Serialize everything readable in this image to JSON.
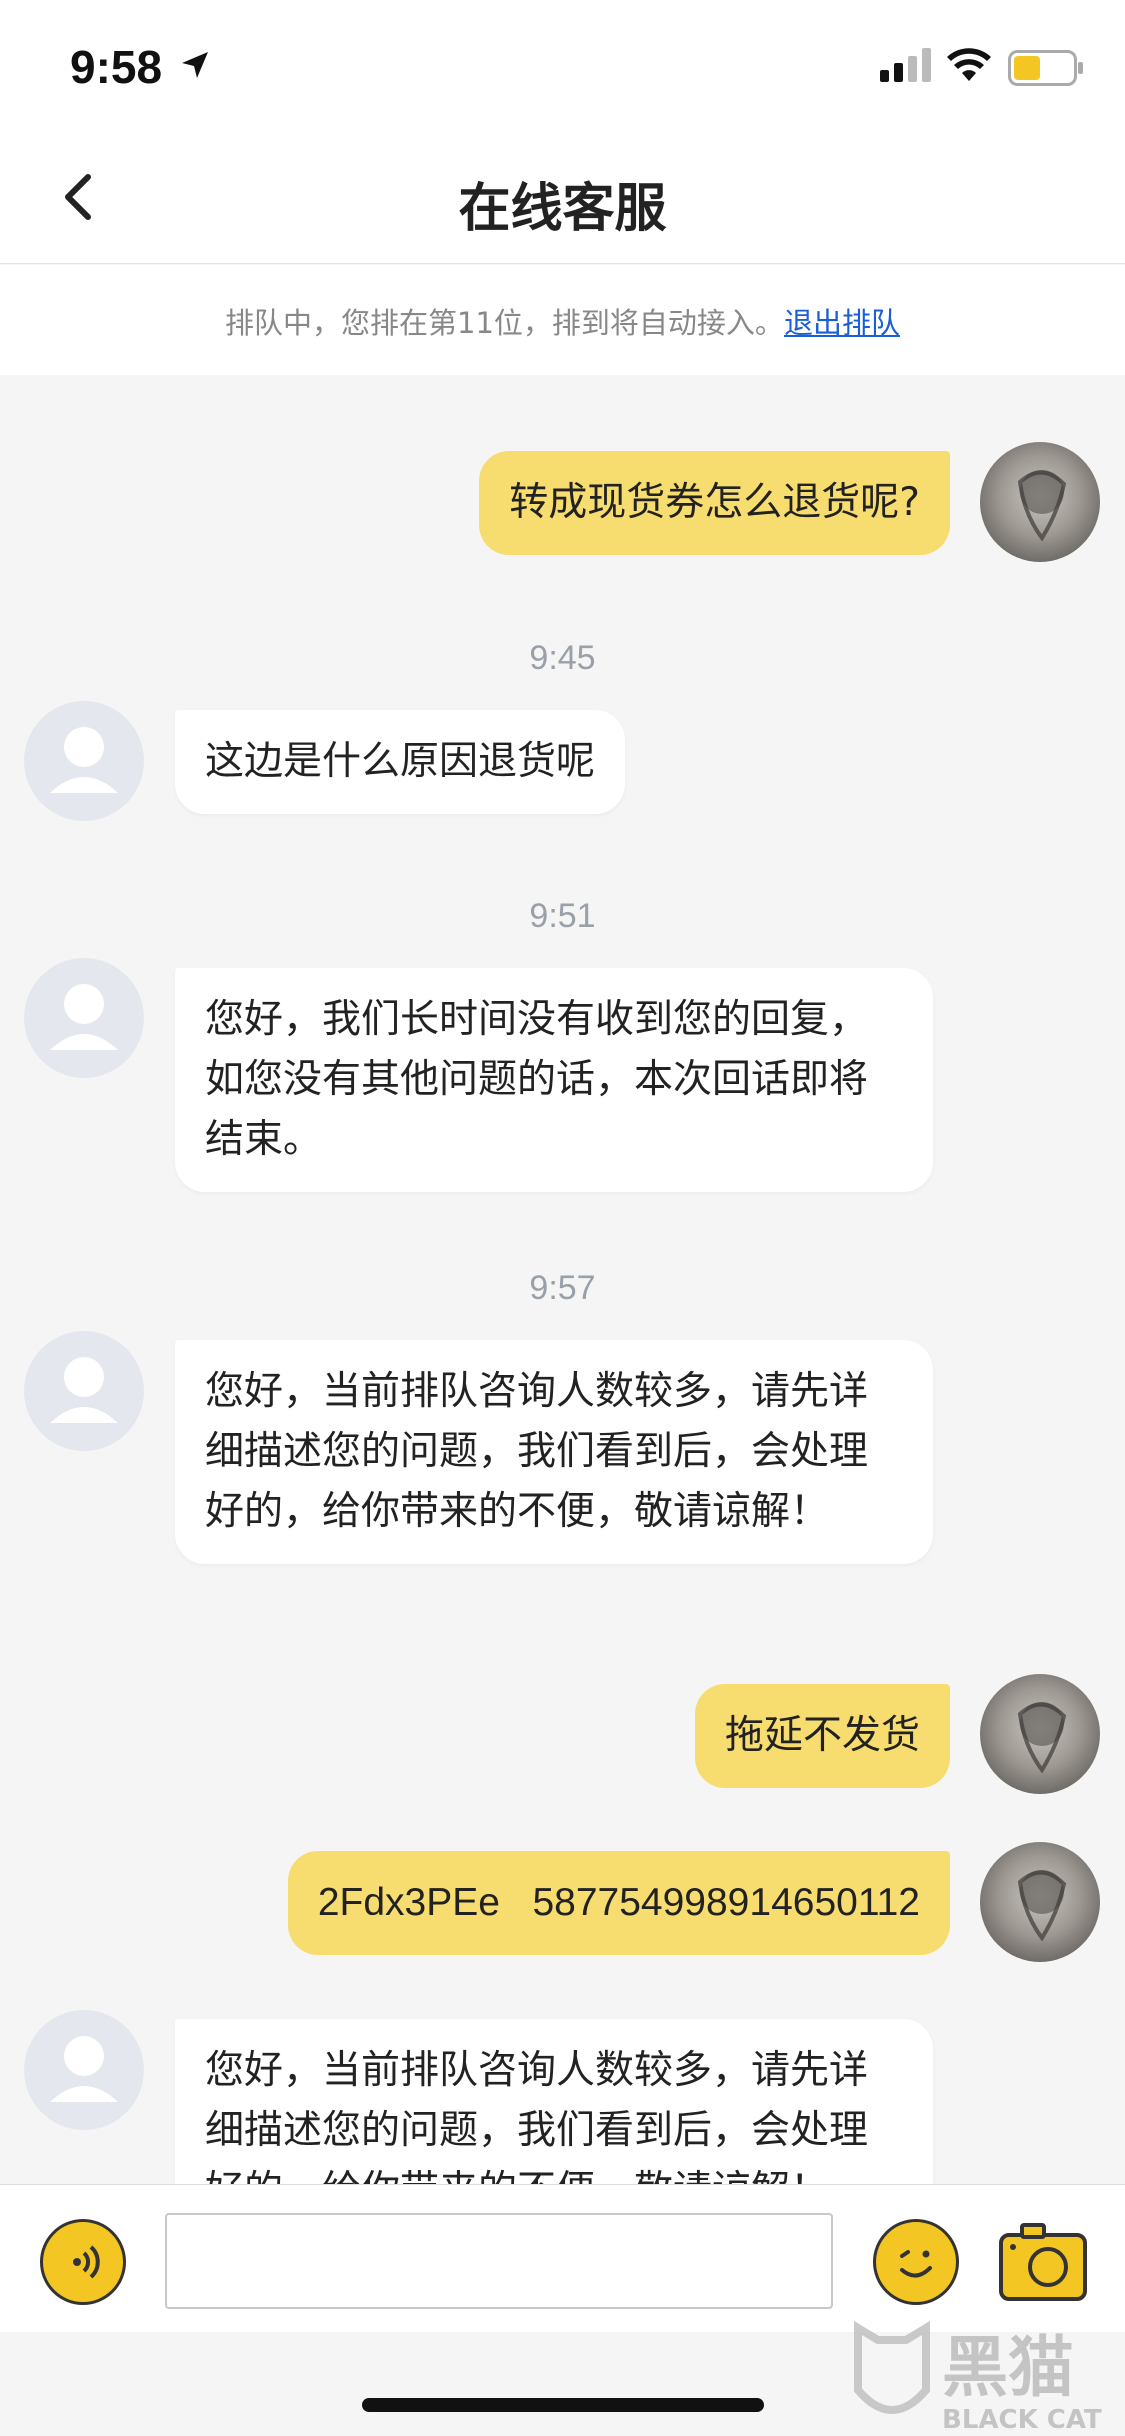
{
  "status_bar": {
    "time": "9:58"
  },
  "nav": {
    "title": "在线客服"
  },
  "queue": {
    "text": "排队中，您排在第11位，排到将自动接入。",
    "exit_link": "退出排队"
  },
  "messages": [
    {
      "from": "user",
      "text": "转成现货券怎么退货呢?"
    },
    {
      "type": "time",
      "text": "9:45"
    },
    {
      "from": "service",
      "text": "这边是什么原因退货呢"
    },
    {
      "type": "time",
      "text": "9:51"
    },
    {
      "from": "service",
      "text": "您好，我们长时间没有收到您的回复，如您没有其他问题的话，本次回话即将结束。"
    },
    {
      "type": "time",
      "text": "9:57"
    },
    {
      "from": "service",
      "text": "您好，当前排队咨询人数较多，请先详细描述您的问题，我们看到后，会处理好的，给你带来的不便，敬请谅解！"
    },
    {
      "from": "user",
      "text": "拖延不发货"
    },
    {
      "from": "user",
      "text": "2Fdx3PEe   587754998914650112"
    },
    {
      "from": "service",
      "text": "您好，当前排队咨询人数较多，请先详细描述您的问题，我们看到后，会处理好的，给你带来的不便，敬请谅解！"
    }
  ],
  "input": {
    "placeholder": "",
    "value": ""
  },
  "watermark": {
    "text_cn": "黑猫",
    "text_en": "BLACK CAT"
  },
  "colors": {
    "accent": "#f3c623",
    "user_bubble": "#f7dc6f",
    "link": "#1a5fd6"
  }
}
